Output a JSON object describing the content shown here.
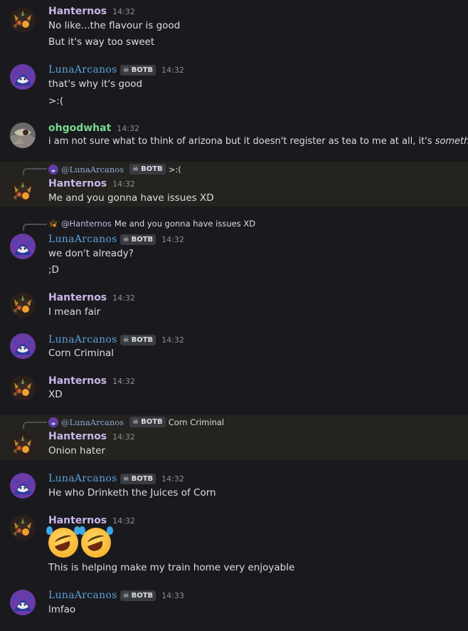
{
  "users": {
    "h": {
      "name": "Hanternos"
    },
    "l": {
      "name": "LunaArcanos",
      "badge": "BOTB"
    },
    "o": {
      "name": "ohgodwhat"
    }
  },
  "colors": {
    "hanternos": "#c9b6e8",
    "luna": "#5aa0d8",
    "ohgodwhat": "#7bd88f",
    "highlight": "#24231f"
  },
  "messages": [
    {
      "time": "14:32",
      "lines": [
        "No like...the flavour is good",
        "But it's way too sweet"
      ]
    },
    {
      "time": "14:32",
      "lines": [
        "that's why it's good",
        ">:("
      ]
    },
    {
      "time": "14:32",
      "text_plain": "i am not sure what to think of arizona but it doesn't register as tea to me at all, it's ",
      "text_em": "something"
    },
    {
      "time": "14:32",
      "reply": {
        "name": "@LunaArcanos",
        "badge": "BOTB",
        "text": ">:("
      },
      "lines": [
        "Me and you gonna have issues XD"
      ]
    },
    {
      "time": "14:32",
      "reply": {
        "name": "@Hanternos",
        "text": "Me and you gonna have issues XD"
      },
      "lines": [
        "we don't already?",
        ";D"
      ]
    },
    {
      "time": "14:32",
      "lines": [
        "I mean fair"
      ]
    },
    {
      "time": "14:32",
      "lines": [
        "Corn Criminal"
      ]
    },
    {
      "time": "14:32",
      "lines": [
        "XD"
      ]
    },
    {
      "time": "14:32",
      "reply": {
        "name": "@LunaArcanos",
        "badge": "BOTB",
        "text": "Corn Criminal"
      },
      "lines": [
        "Onion hater"
      ]
    },
    {
      "time": "14:32",
      "lines": [
        "He who Drinketh the Juices of Corn"
      ]
    },
    {
      "time": "14:32",
      "emoji": [
        "rofl-emoji",
        "rofl-emoji"
      ],
      "lines": [
        "This is helping make my train home very enjoyable"
      ]
    },
    {
      "time": "14:33",
      "lines": [
        "lmfao"
      ]
    }
  ]
}
